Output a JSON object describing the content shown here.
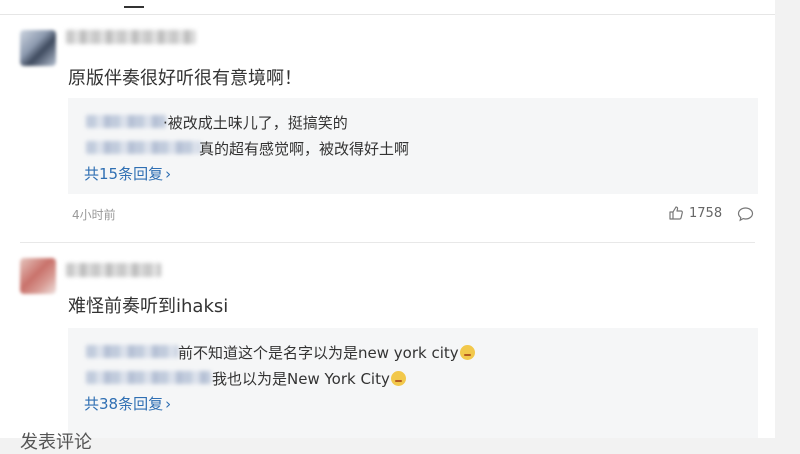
{
  "comments": [
    {
      "text": "原版伴奏很好听很有意境啊！",
      "replies": [
        {
          "text": "·被改成土味儿了，挺搞笑的"
        },
        {
          "text": "真的超有感觉啊，被改得好土啊"
        }
      ],
      "more_replies": "共15条回复",
      "time": "4小时前",
      "likes": "1758"
    },
    {
      "text": "难怪前奏听到ihaksi",
      "replies": [
        {
          "text": "前不知道这个是名字以为是new york city"
        },
        {
          "text": "我也以为是New York City"
        }
      ],
      "more_replies": "共38条回复"
    }
  ],
  "footer": {
    "partial_label": "发表评论"
  },
  "icons": {
    "like": "thumbs-up-icon",
    "comment": "comment-icon",
    "chevron": "chevron-right-icon"
  },
  "colors": {
    "link": "#2f6fb3",
    "reply_bg": "#f5f6f7",
    "meta": "#999999"
  }
}
